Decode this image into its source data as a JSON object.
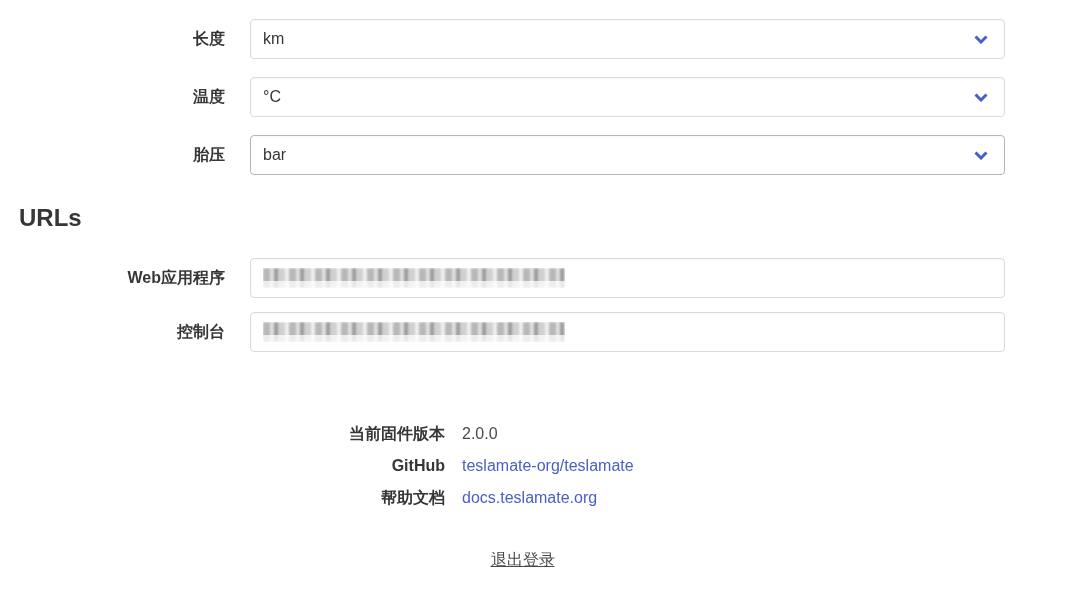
{
  "units": [
    {
      "label": "长度",
      "value": "km",
      "focused": false
    },
    {
      "label": "温度",
      "value": "°C",
      "focused": false
    },
    {
      "label": "胎压",
      "value": "bar",
      "focused": true
    }
  ],
  "urls": {
    "heading": "URLs",
    "fields": [
      {
        "label": "Web应用程序",
        "blurred": true
      },
      {
        "label": "控制台",
        "blurred": true
      }
    ]
  },
  "about": [
    {
      "label": "当前固件版本",
      "kind": "text",
      "value": "2.0.0"
    },
    {
      "label": "GitHub",
      "kind": "link",
      "value": "teslamate-org/teslamate"
    },
    {
      "label": "帮助文档",
      "kind": "link",
      "value": "docs.teslamate.org"
    }
  ],
  "logout": "退出登录"
}
